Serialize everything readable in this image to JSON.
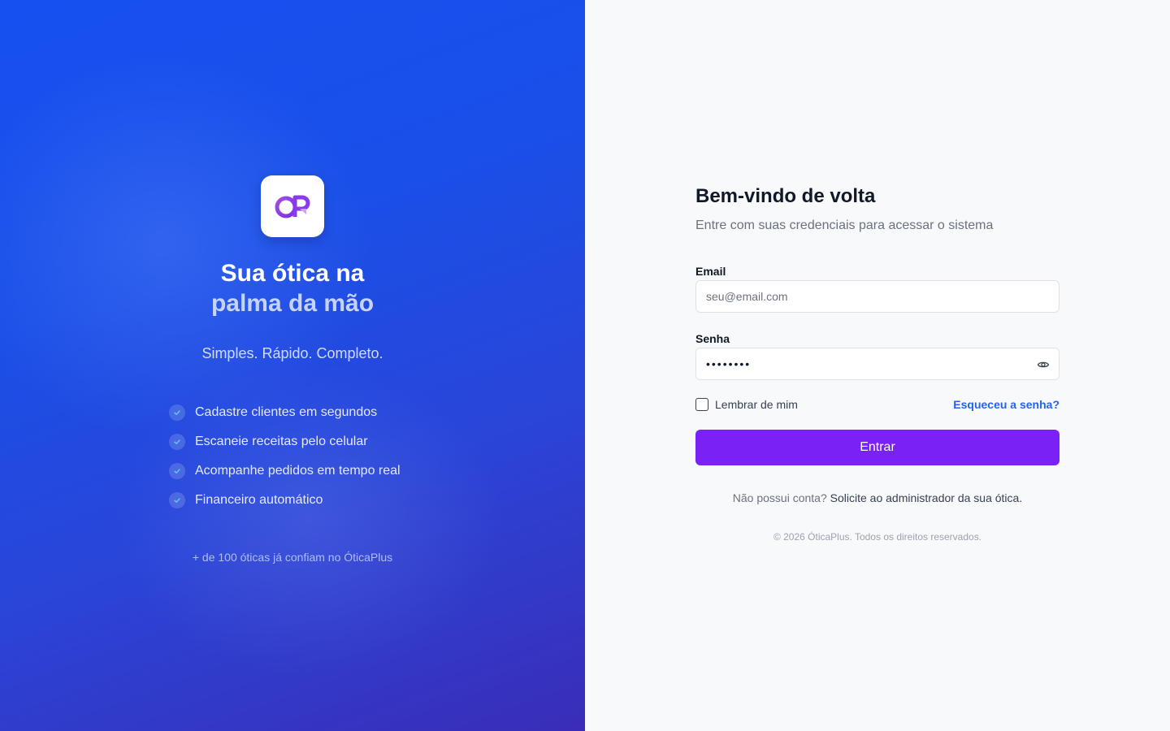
{
  "brand": {
    "logo_icon": "oticaplus-logo-icon",
    "title_line1": "Sua ótica na",
    "title_line2": "palma da mão",
    "tagline": "Simples. Rápido. Completo.",
    "features": [
      "Cadastre clientes em segundos",
      "Escaneie receitas pelo celular",
      "Acompanhe pedidos em tempo real",
      "Financeiro automático"
    ],
    "trust": "+ de 100 óticas já confiam no ÓticaPlus",
    "colors": {
      "gradient_start": "#1650f0",
      "gradient_end": "#3a2db8",
      "logo_purple": "#8b3be8"
    }
  },
  "login": {
    "title": "Bem-vindo de volta",
    "subtitle": "Entre com suas credenciais para acessar o sistema",
    "email": {
      "label": "Email",
      "placeholder": "seu@email.com",
      "value": ""
    },
    "password": {
      "label": "Senha",
      "value": "••••••••",
      "toggle_icon": "eye-icon"
    },
    "remember": {
      "label": "Lembrar de mim",
      "checked": false
    },
    "forgot": "Esqueceu a senha?",
    "submit": "Entrar",
    "signup_prompt": "Não possui conta?",
    "signup_link": "Solicite ao administrador da sua ótica.",
    "copyright": "© 2026 ÓticaPlus. Todos os direitos reservados.",
    "colors": {
      "accent": "#7a22f5",
      "link": "#2563eb",
      "background": "#f7f9fb"
    }
  }
}
